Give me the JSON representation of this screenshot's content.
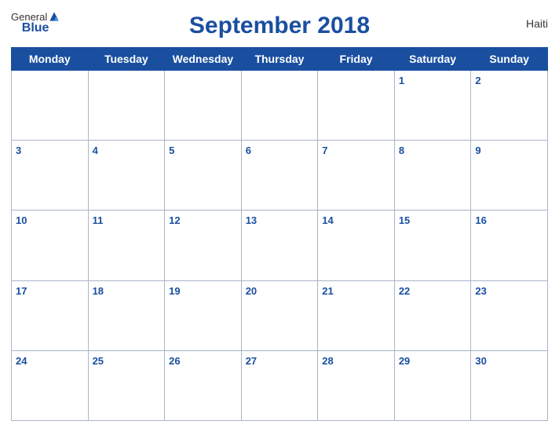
{
  "header": {
    "title": "September 2018",
    "country": "Haiti",
    "logo_general": "General",
    "logo_blue": "Blue"
  },
  "weekdays": [
    "Monday",
    "Tuesday",
    "Wednesday",
    "Thursday",
    "Friday",
    "Saturday",
    "Sunday"
  ],
  "weeks": [
    [
      null,
      null,
      null,
      null,
      null,
      1,
      2
    ],
    [
      3,
      4,
      5,
      6,
      7,
      8,
      9
    ],
    [
      10,
      11,
      12,
      13,
      14,
      15,
      16
    ],
    [
      17,
      18,
      19,
      20,
      21,
      22,
      23
    ],
    [
      24,
      25,
      26,
      27,
      28,
      29,
      30
    ]
  ]
}
